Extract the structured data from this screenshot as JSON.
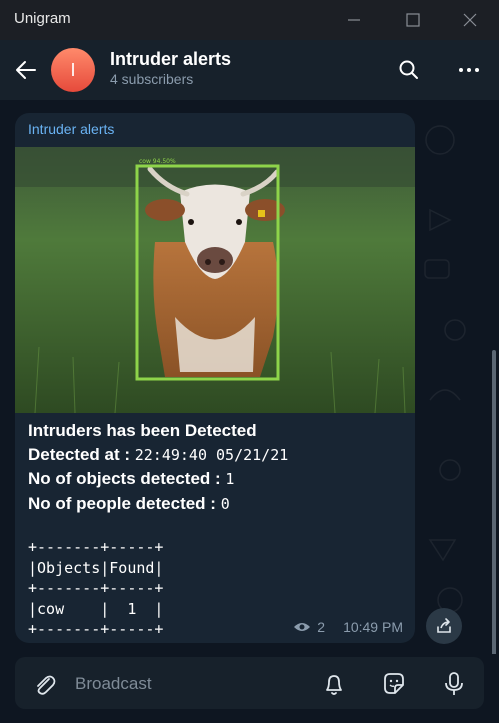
{
  "window": {
    "title": "Unigram"
  },
  "header": {
    "avatar_letter": "I",
    "title": "Intruder alerts",
    "subtitle": "4 subscribers"
  },
  "message": {
    "author": "Intruder alerts",
    "image": {
      "detection_label": "cow 94.50%"
    },
    "lines": {
      "heading": "Intruders has been Detected",
      "detected_label": "Detected at : ",
      "detected_value": " 22:49:40 05/21/21",
      "objects_label": "No of objects detected : ",
      "objects_value": " 1",
      "people_label": "No of people detected : ",
      "people_value": " 0"
    },
    "table": {
      "border": "+-------+-----+",
      "header": "|Objects|Found|",
      "row": "|cow    |  1  |",
      "bottom": "+-------+-----+"
    },
    "views": "2",
    "time": "10:49 PM"
  },
  "composer": {
    "placeholder": "Broadcast"
  },
  "icons": {
    "back": "arrow-left-icon",
    "search": "search-icon",
    "more": "more-icon",
    "attach": "paperclip-icon",
    "bell": "bell-icon",
    "sticker": "sticker-icon",
    "mic": "mic-icon",
    "share": "share-icon",
    "views": "eye-icon"
  },
  "colors": {
    "accent": "#6ab3f3",
    "detection_box": "#8ed44a"
  }
}
